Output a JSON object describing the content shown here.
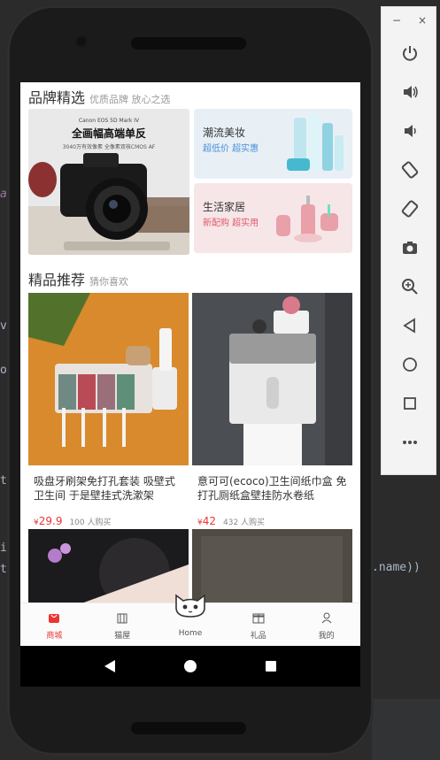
{
  "ide": {
    "left_chars": [
      "a",
      "v",
      "o",
      "t",
      "i",
      "t"
    ],
    "right_code": ".name))"
  },
  "brand": {
    "title": "品牌精选",
    "subtitle": "优质品牌 放心之选",
    "banner": {
      "model": "Canon EOS 5D Mark IV",
      "headline": "全画幅高端单反",
      "detail": "3040万有效像素 全像素双核CMOS AF"
    },
    "cards": [
      {
        "title": "潮流美妆",
        "tagline": "超低价 超实惠",
        "tag_color": "#4a90d9",
        "bg": "#e8f0f6"
      },
      {
        "title": "生活家居",
        "tagline": "新配购 超实用",
        "tag_color": "#e05a6a",
        "bg": "#f6e6e8"
      }
    ]
  },
  "recommend": {
    "title": "精品推荐",
    "subtitle": "猜你喜欢",
    "products": [
      {
        "title": "吸盘牙刷架免打孔套装 吸壁式卫生间 于是壁挂式洗漱架",
        "price_symbol": "¥",
        "price": "29.9",
        "sold": "100 人购买"
      },
      {
        "title": "意可可(ecoco)卫生间纸巾盒 免打孔厕纸盒壁挂防水卷纸",
        "price_symbol": "¥",
        "price": "42",
        "sold": "432 人购买"
      }
    ]
  },
  "tabbar": {
    "items": [
      {
        "label": "商城",
        "icon": "shop-bag-icon",
        "active": true
      },
      {
        "label": "猫屋",
        "icon": "cat-house-icon",
        "active": false
      },
      {
        "label": "Home",
        "icon": "cat-face-icon",
        "active": false
      },
      {
        "label": "礼品",
        "icon": "gift-icon",
        "active": false
      },
      {
        "label": "我的",
        "icon": "user-icon",
        "active": false
      }
    ]
  },
  "navbar": {
    "buttons": [
      "back-icon",
      "home-circle-icon",
      "recents-square-icon"
    ]
  },
  "emulator": {
    "minimize": "−",
    "close": "×",
    "buttons": [
      "power-icon",
      "volume-up-icon",
      "volume-down-icon",
      "rotate-left-icon",
      "rotate-right-icon",
      "camera-icon",
      "zoom-icon",
      "back-icon",
      "home-icon",
      "overview-icon",
      "more-icon"
    ]
  },
  "colors": {
    "accent": "#e33333",
    "tabbar_bg": "#fbfbfb",
    "navbar_bg": "#000000"
  }
}
